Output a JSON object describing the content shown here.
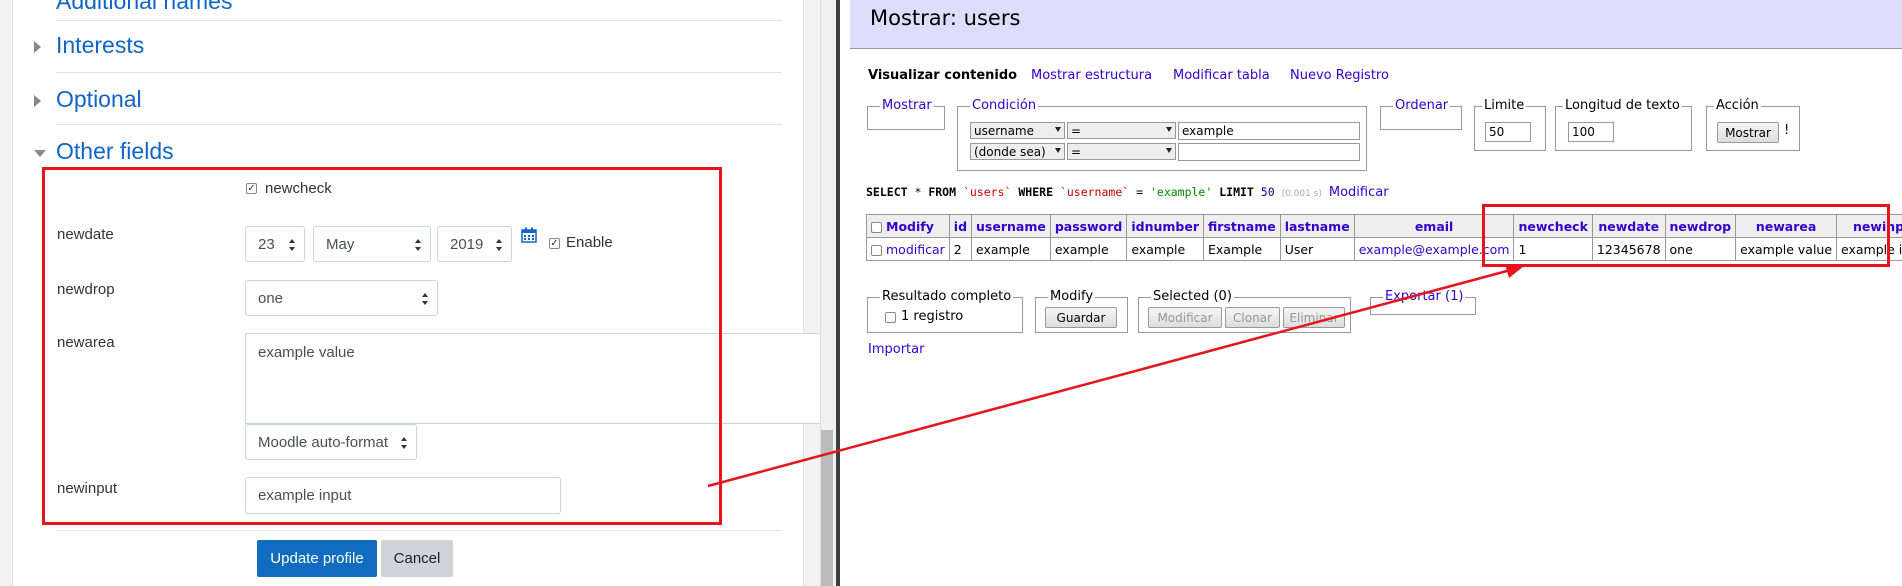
{
  "moodle": {
    "sections": {
      "additional_names": "Additional names",
      "interests": "Interests",
      "optional": "Optional",
      "other_fields": "Other fields"
    },
    "newcheck": {
      "label": "newcheck",
      "checked": true
    },
    "newdate": {
      "label": "newdate",
      "day": "23",
      "month": "May",
      "year": "2019",
      "calendar_icon": "calendar-icon",
      "enable_label": "Enable",
      "enable_checked": true
    },
    "newdrop": {
      "label": "newdrop",
      "value": "one"
    },
    "newarea": {
      "label": "newarea",
      "value": "example value",
      "format": "Moodle auto-format"
    },
    "newinput": {
      "label": "newinput",
      "value": "example input"
    },
    "buttons": {
      "update": "Update profile",
      "cancel": "Cancel"
    }
  },
  "adminer": {
    "title": "Mostrar: users",
    "nav": {
      "current": "Visualizar contenido",
      "structure": "Mostrar estructura",
      "alter": "Modificar tabla",
      "new_record": "Nuevo Registro"
    },
    "filters": {
      "show_legend": "Mostrar",
      "condition_legend": "Condición",
      "cond1_column": "username",
      "cond1_op": "=",
      "cond1_value": "example",
      "cond2_column": "(donde sea)",
      "cond2_op": "=",
      "cond2_value": "",
      "order_legend": "Ordenar",
      "limit_legend": "Limite",
      "limit_value": "50",
      "text_length_legend": "Longitud de texto",
      "text_length_value": "100",
      "action_legend": "Acción",
      "action_button": "Mostrar",
      "action_suffix": "!"
    },
    "sql": {
      "select": "SELECT",
      "star": " * ",
      "from": "FROM",
      "table": "`users`",
      "where": "WHERE",
      "column": "`username`",
      "eq": " = ",
      "value": "'example'",
      "limit": "LIMIT",
      "limit_num": "50",
      "time": "(0.001 s)",
      "edit_link": "Modificar"
    },
    "table": {
      "headers": [
        "Modify",
        "id",
        "username",
        "password",
        "idnumber",
        "firstname",
        "lastname",
        "email",
        "newcheck",
        "newdate",
        "newdrop",
        "newarea",
        "newinput"
      ],
      "row": {
        "edit": "modificar",
        "cells": [
          "2",
          "example",
          "example",
          "example",
          "Example",
          "User",
          "example@example.com",
          "1",
          "12345678",
          "one",
          "example value",
          "example input"
        ]
      }
    },
    "bottom": {
      "full_result_legend": "Resultado completo",
      "full_result_label": "1 registro",
      "modify_legend": "Modify",
      "save_button": "Guardar",
      "selected_legend": "Selected (0)",
      "edit_button": "Modificar",
      "clone_button": "Clonar",
      "delete_button": "Eliminar",
      "export_legend": "Exportar (1)",
      "import_link": "Importar"
    }
  },
  "colors": {
    "moodle_link": "#1066c8",
    "moodle_primary": "#0f6cbf",
    "adminer_link": "#3300cc",
    "adminer_header": "#ddddff",
    "annotation": "#e8141b"
  }
}
